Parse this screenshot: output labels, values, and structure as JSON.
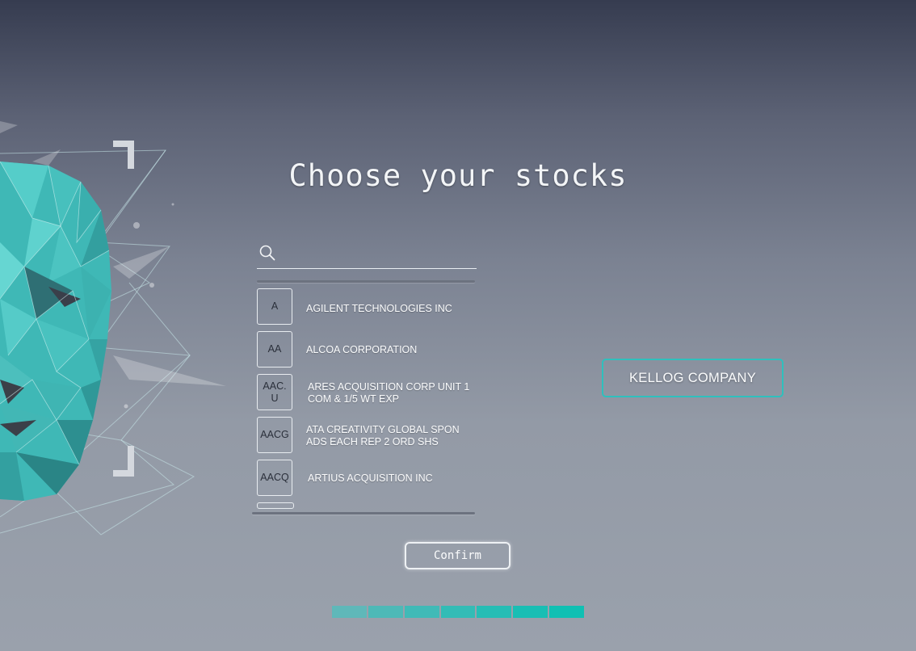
{
  "title": "Choose your stocks",
  "search": {
    "value": "",
    "placeholder": ""
  },
  "stocks": [
    {
      "ticker": "A",
      "name": "AGILENT TECHNOLOGIES INC"
    },
    {
      "ticker": "AA",
      "name": "ALCOA CORPORATION"
    },
    {
      "ticker": "AAC.U",
      "name": "ARES ACQUISITION CORP UNIT 1 COM & 1/5 WT EXP"
    },
    {
      "ticker": "AACG",
      "name": "ATA CREATIVITY GLOBAL SPON ADS EACH REP 2 ORD SHS"
    },
    {
      "ticker": "AACQ",
      "name": "ARTIUS ACQUISITION INC"
    }
  ],
  "selected_stock": "KELLOG COMPANY",
  "confirm_label": "Confirm",
  "progress": {
    "segments": 7,
    "colors": [
      "#5fb8b9",
      "#4db9b7",
      "#40bab7",
      "#33bcb6",
      "#26bdb5",
      "#19beb4",
      "#10c0b3"
    ]
  },
  "colors": {
    "accent": "#2fc0bd",
    "face": "#4fc9c6"
  }
}
